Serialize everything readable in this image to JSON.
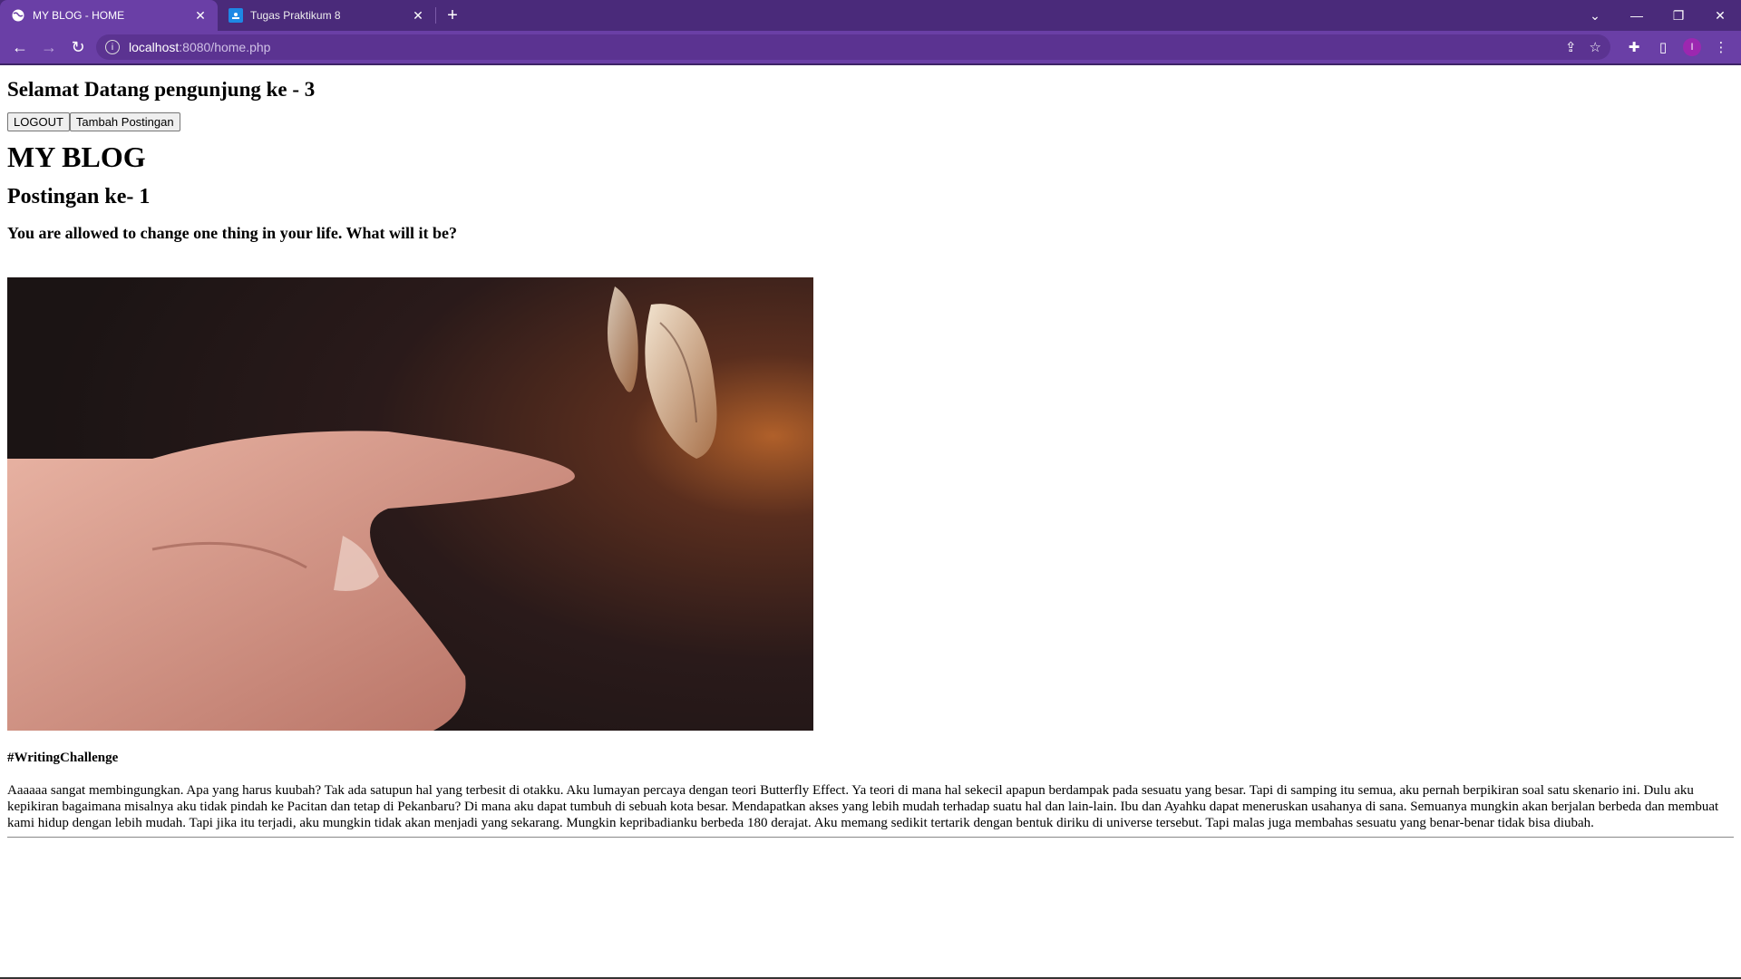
{
  "browser": {
    "tabs": [
      {
        "title": "MY BLOG - HOME",
        "active": true
      },
      {
        "title": "Tugas Praktikum 8",
        "active": false
      }
    ],
    "address": {
      "host": "localhost",
      "path": ":8080/home.php"
    },
    "profile_initial": "I"
  },
  "page": {
    "welcome": "Selamat Datang pengunjung ke - 3",
    "buttons": {
      "logout": "LOGOUT",
      "add_post": "Tambah Postingan"
    },
    "blog_title": "MY BLOG",
    "post_heading": "Postingan ke- 1",
    "post_question": "You are allowed to change one thing in your life. What will it be?",
    "post_tag": "#WritingChallenge",
    "post_body": "Aaaaaa sangat membingungkan. Apa yang harus kuubah? Tak ada satupun hal yang terbesit di otakku. Aku lumayan percaya dengan teori Butterfly Effect. Ya teori di mana hal sekecil apapun berdampak pada sesuatu yang besar. Tapi di samping itu semua, aku pernah berpikiran soal satu skenario ini. Dulu aku kepikiran bagaimana misalnya aku tidak pindah ke Pacitan dan tetap di Pekanbaru? Di mana aku dapat tumbuh di sebuah kota besar. Mendapatkan akses yang lebih mudah terhadap suatu hal dan lain-lain. Ibu dan Ayahku dapat meneruskan usahanya di sana. Semuanya mungkin akan berjalan berbeda dan membuat kami hidup dengan lebih mudah. Tapi jika itu terjadi, aku mungkin tidak akan menjadi yang sekarang. Mungkin kepribadianku berbeda 180 derajat. Aku memang sedikit tertarik dengan bentuk diriku di universe tersebut. Tapi malas juga membahas sesuatu yang benar-benar tidak bisa diubah."
  },
  "colors": {
    "tabstrip": "#4a2a7a",
    "toolbar": "#6a3fa6",
    "omnibox": "#5b3391"
  }
}
